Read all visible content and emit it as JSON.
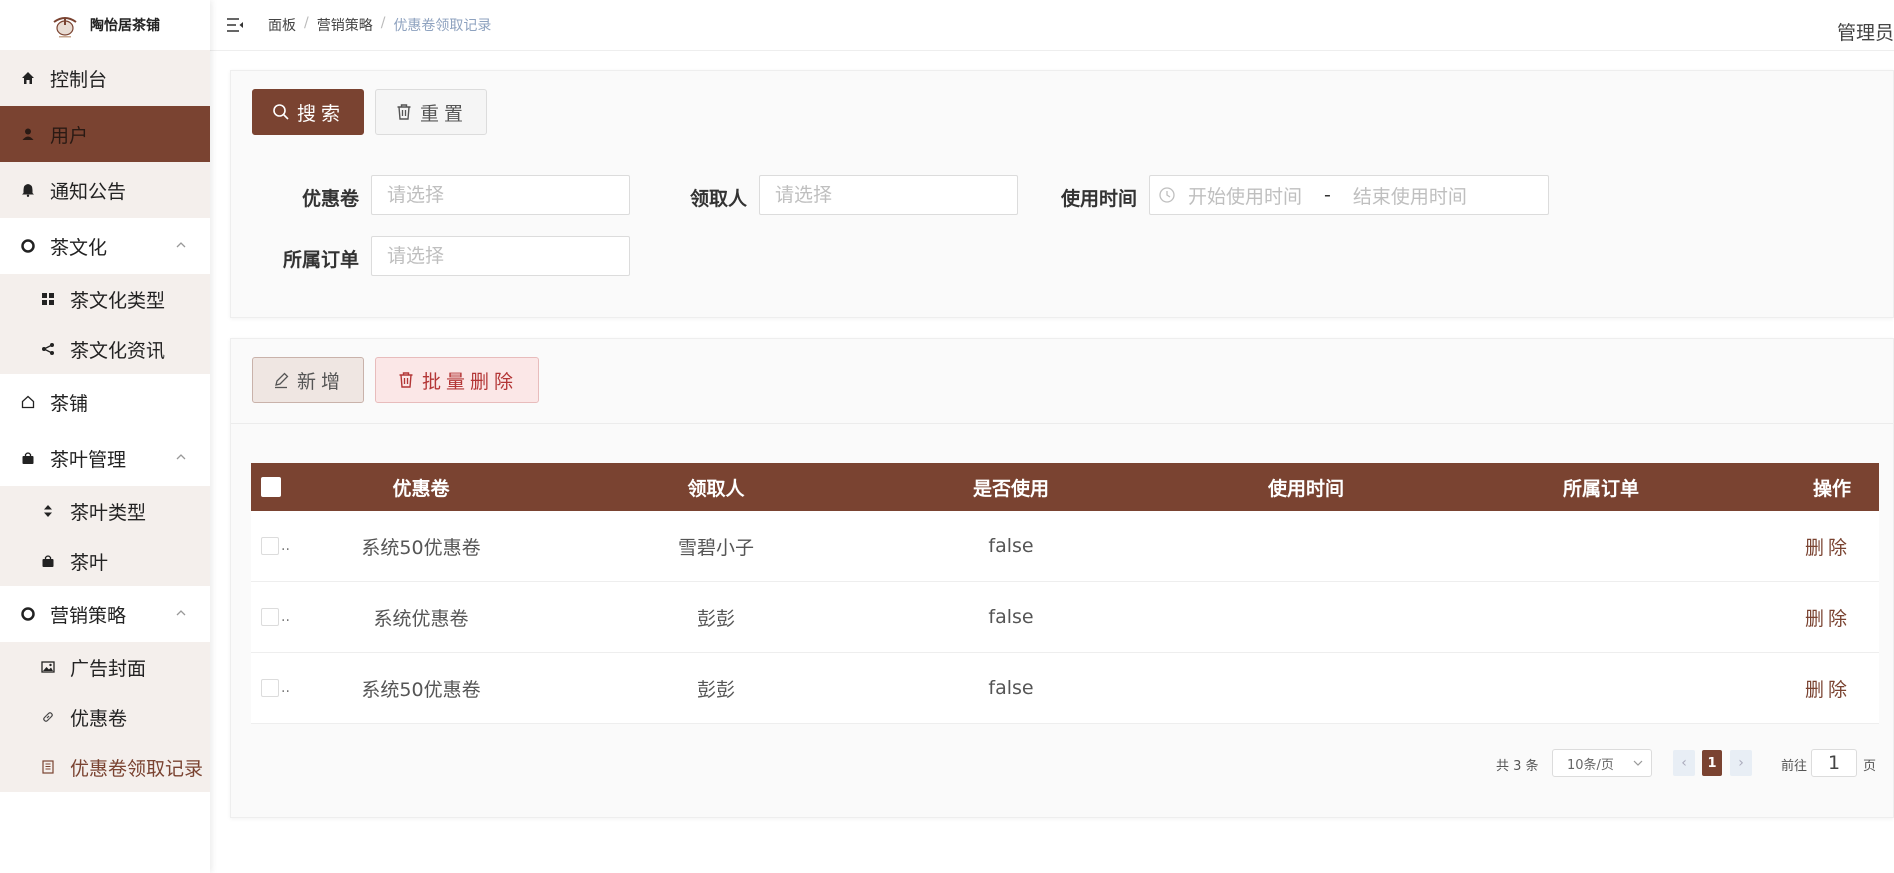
{
  "brand": {
    "name": "陶怡居茶铺"
  },
  "sidebar": {
    "items": [
      {
        "label": "控制台",
        "icon": "home-icon"
      },
      {
        "label": "用户",
        "icon": "user-icon"
      },
      {
        "label": "通知公告",
        "icon": "bell-icon"
      },
      {
        "label": "茶文化",
        "icon": "lifebuoy-icon",
        "children": [
          {
            "label": "茶文化类型",
            "icon": "grid-icon"
          },
          {
            "label": "茶文化资讯",
            "icon": "share-icon"
          }
        ]
      },
      {
        "label": "茶铺",
        "icon": "house-outline-icon"
      },
      {
        "label": "茶叶管理",
        "icon": "bag-icon",
        "children": [
          {
            "label": "茶叶类型",
            "icon": "sort-icon"
          },
          {
            "label": "茶叶",
            "icon": "bag-icon"
          }
        ]
      },
      {
        "label": "营销策略",
        "icon": "lifebuoy-icon",
        "children": [
          {
            "label": "广告封面",
            "icon": "image-icon"
          },
          {
            "label": "优惠卷",
            "icon": "link-icon"
          },
          {
            "label": "优惠卷领取记录",
            "icon": "document-icon"
          }
        ]
      }
    ]
  },
  "header": {
    "breadcrumb": [
      "面板",
      "营销策略",
      "优惠卷领取记录"
    ],
    "separator": "/",
    "user": "管理员"
  },
  "search": {
    "search_label": "搜索",
    "reset_label": "重置",
    "fields": {
      "coupon": {
        "label": "优惠卷",
        "placeholder": "请选择"
      },
      "receiver": {
        "label": "领取人",
        "placeholder": "请选择"
      },
      "use_time": {
        "label": "使用时间",
        "start_placeholder": "开始使用时间",
        "separator": "-",
        "end_placeholder": "结束使用时间"
      },
      "order": {
        "label": "所属订单",
        "placeholder": "请选择"
      }
    }
  },
  "actions": {
    "add_label": "新增",
    "batch_delete_label": "批量删除"
  },
  "table": {
    "columns": [
      "优惠卷",
      "领取人",
      "是否使用",
      "使用时间",
      "所属订单",
      "操作"
    ],
    "rows": [
      {
        "coupon": "系统50优惠卷",
        "receiver": "雪碧小子",
        "used": "false",
        "use_time": "",
        "order": "",
        "action": "删除"
      },
      {
        "coupon": "系统优惠卷",
        "receiver": "彭彭",
        "used": "false",
        "use_time": "",
        "order": "",
        "action": "删除"
      },
      {
        "coupon": "系统50优惠卷",
        "receiver": "彭彭",
        "used": "false",
        "use_time": "",
        "order": "",
        "action": "删除"
      }
    ],
    "ellipsis": ".."
  },
  "pagination": {
    "total_text": "共 3 条",
    "page_size": "10条/页",
    "prev": "‹",
    "next": "›",
    "current_page": "1",
    "goto_label": "前往",
    "goto_value": "1",
    "page_unit": "页"
  },
  "colors": {
    "brand": "#7a4331",
    "danger": "#b33636",
    "breadcrumb_current": "#8ea2bf"
  }
}
